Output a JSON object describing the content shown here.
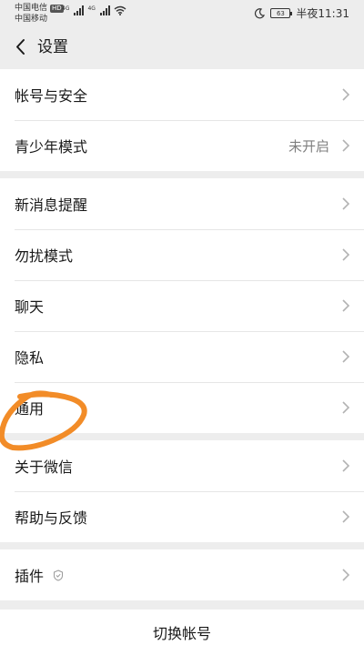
{
  "status_bar": {
    "carrier1": "中国电信",
    "hd": "HD",
    "carrier2": "中国移动",
    "network1": "4G",
    "network2": "4G",
    "battery": "63",
    "time": "半夜11:31"
  },
  "nav": {
    "title": "设置"
  },
  "groups": [
    {
      "rows": [
        {
          "label": "帐号与安全"
        },
        {
          "label": "青少年模式",
          "value": "未开启"
        }
      ]
    },
    {
      "rows": [
        {
          "label": "新消息提醒"
        },
        {
          "label": "勿扰模式"
        },
        {
          "label": "聊天"
        },
        {
          "label": "隐私"
        },
        {
          "label": "通用"
        }
      ]
    },
    {
      "rows": [
        {
          "label": "关于微信"
        },
        {
          "label": "帮助与反馈"
        }
      ]
    },
    {
      "rows": [
        {
          "label": "插件"
        }
      ]
    }
  ],
  "footer": {
    "switch_account": "切换帐号"
  },
  "colors": {
    "background": "#ededed",
    "annotation": "#f28c28"
  }
}
